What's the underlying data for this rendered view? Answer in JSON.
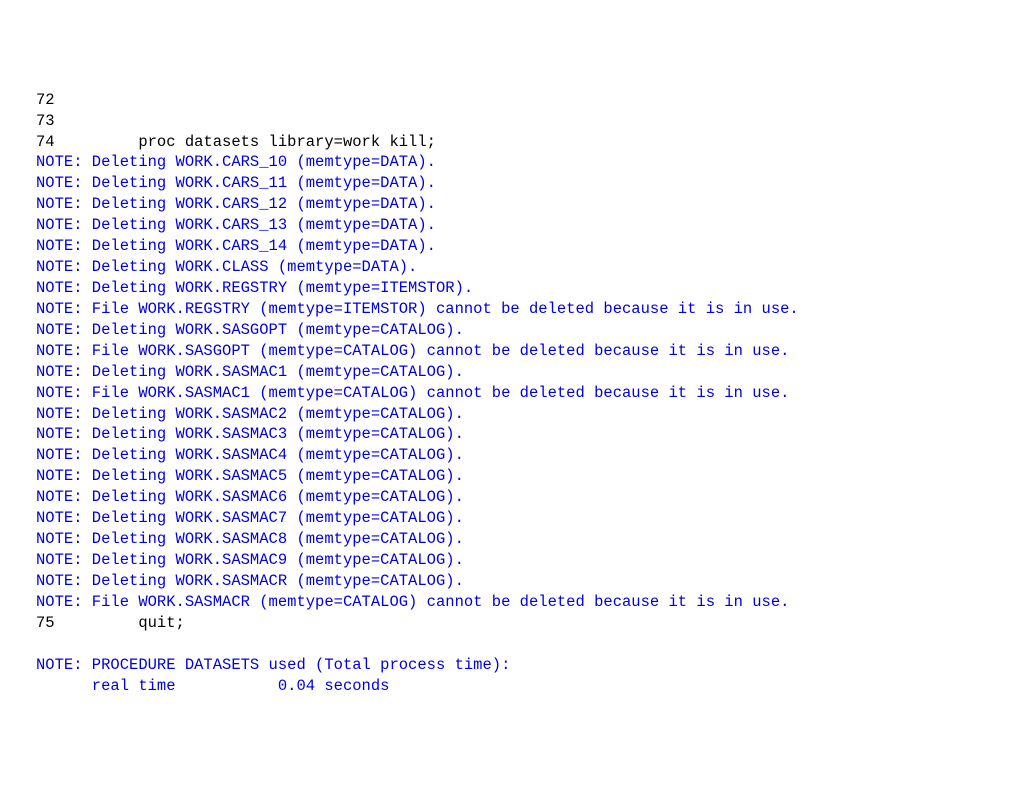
{
  "log": {
    "lines": [
      {
        "color": "black",
        "text": "72         "
      },
      {
        "color": "black",
        "text": "73         "
      },
      {
        "color": "black",
        "text": "74         proc datasets library=work kill;"
      },
      {
        "color": "blue",
        "text": "NOTE: Deleting WORK.CARS_10 (memtype=DATA)."
      },
      {
        "color": "blue",
        "text": "NOTE: Deleting WORK.CARS_11 (memtype=DATA)."
      },
      {
        "color": "blue",
        "text": "NOTE: Deleting WORK.CARS_12 (memtype=DATA)."
      },
      {
        "color": "blue",
        "text": "NOTE: Deleting WORK.CARS_13 (memtype=DATA)."
      },
      {
        "color": "blue",
        "text": "NOTE: Deleting WORK.CARS_14 (memtype=DATA)."
      },
      {
        "color": "blue",
        "text": "NOTE: Deleting WORK.CLASS (memtype=DATA)."
      },
      {
        "color": "blue",
        "text": "NOTE: Deleting WORK.REGSTRY (memtype=ITEMSTOR)."
      },
      {
        "color": "blue",
        "text": "NOTE: File WORK.REGSTRY (memtype=ITEMSTOR) cannot be deleted because it is in use."
      },
      {
        "color": "blue",
        "text": "NOTE: Deleting WORK.SASGOPT (memtype=CATALOG)."
      },
      {
        "color": "blue",
        "text": "NOTE: File WORK.SASGOPT (memtype=CATALOG) cannot be deleted because it is in use."
      },
      {
        "color": "blue",
        "text": "NOTE: Deleting WORK.SASMAC1 (memtype=CATALOG)."
      },
      {
        "color": "blue",
        "text": "NOTE: File WORK.SASMAC1 (memtype=CATALOG) cannot be deleted because it is in use."
      },
      {
        "color": "blue",
        "text": "NOTE: Deleting WORK.SASMAC2 (memtype=CATALOG)."
      },
      {
        "color": "blue",
        "text": "NOTE: Deleting WORK.SASMAC3 (memtype=CATALOG)."
      },
      {
        "color": "blue",
        "text": "NOTE: Deleting WORK.SASMAC4 (memtype=CATALOG)."
      },
      {
        "color": "blue",
        "text": "NOTE: Deleting WORK.SASMAC5 (memtype=CATALOG)."
      },
      {
        "color": "blue",
        "text": "NOTE: Deleting WORK.SASMAC6 (memtype=CATALOG)."
      },
      {
        "color": "blue",
        "text": "NOTE: Deleting WORK.SASMAC7 (memtype=CATALOG)."
      },
      {
        "color": "blue",
        "text": "NOTE: Deleting WORK.SASMAC8 (memtype=CATALOG)."
      },
      {
        "color": "blue",
        "text": "NOTE: Deleting WORK.SASMAC9 (memtype=CATALOG)."
      },
      {
        "color": "blue",
        "text": "NOTE: Deleting WORK.SASMACR (memtype=CATALOG)."
      },
      {
        "color": "blue",
        "text": "NOTE: File WORK.SASMACR (memtype=CATALOG) cannot be deleted because it is in use."
      },
      {
        "color": "black",
        "text": "75         quit;"
      },
      {
        "color": "black",
        "text": " "
      },
      {
        "color": "blue",
        "text": "NOTE: PROCEDURE DATASETS used (Total process time):"
      },
      {
        "color": "blue",
        "text": "      real time           0.04 seconds"
      }
    ]
  }
}
